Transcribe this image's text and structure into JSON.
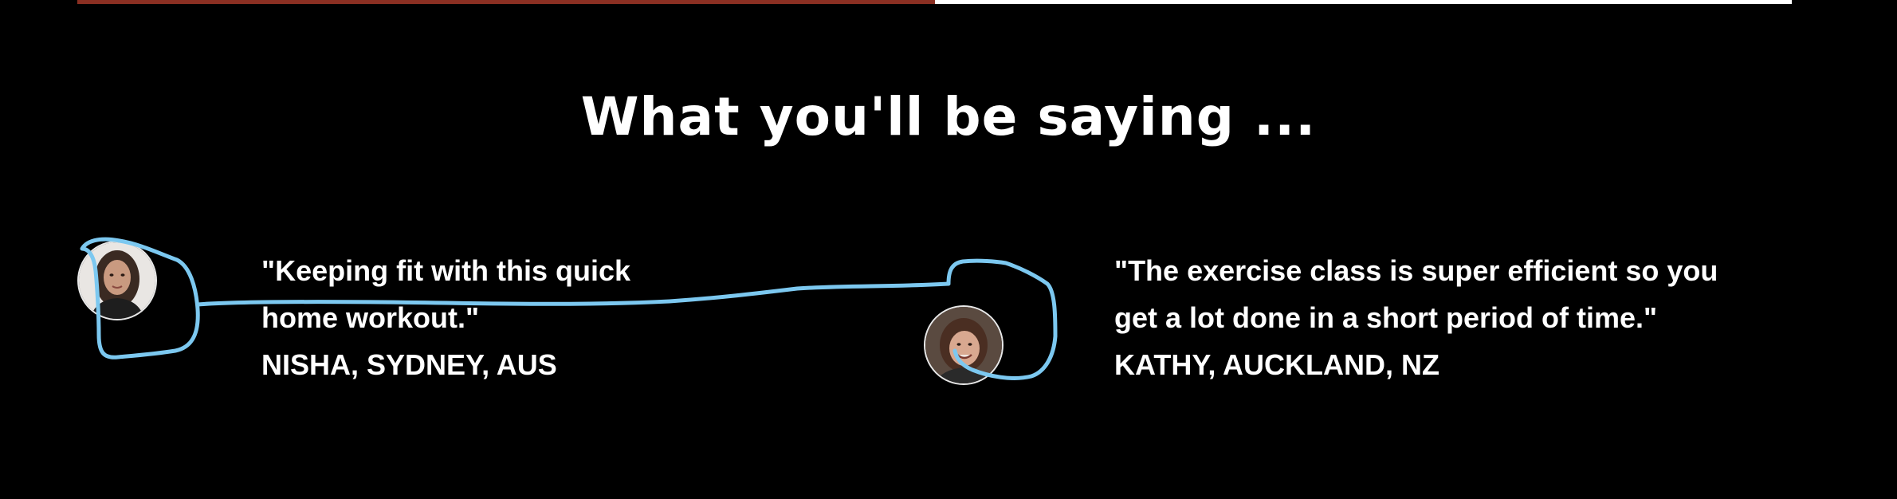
{
  "progress": {
    "fraction": 0.5,
    "fill_color": "#8a2f22",
    "track_color": "#ffffff"
  },
  "section": {
    "title": "What you'll be saying ..."
  },
  "testimonials": [
    {
      "quote": "\"Keeping fit with this quick home workout.\"",
      "author": "NISHA, SYDNEY, AUS",
      "avatar_icon": "avatar-woman-long-hair"
    },
    {
      "quote": "\"The exercise class is super efficient so you get a lot done in a short period of time.\"",
      "author": "KATHY, AUCKLAND, NZ",
      "avatar_icon": "avatar-woman-smiling"
    }
  ],
  "annotation": {
    "color": "#7cc8f0",
    "type": "hand-drawn-connector"
  }
}
